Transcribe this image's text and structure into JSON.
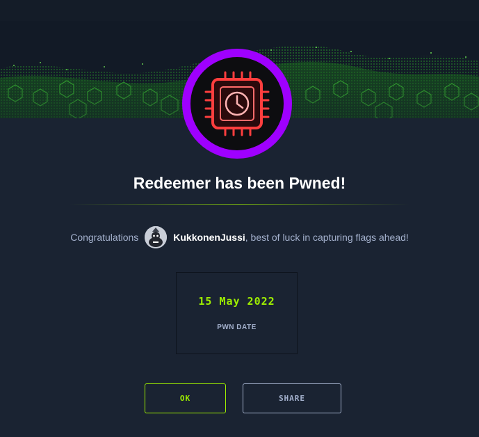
{
  "dialog": {
    "title": "Redeemer has been Pwned!",
    "congrats_prefix": "Congratulations",
    "username": "KukkonenJussi",
    "congrats_suffix": ", best of luck in capturing flags ahead!",
    "pwn_date": "15 May 2022",
    "pwn_date_label": "PWN DATE",
    "ok_label": "OK",
    "share_label": "SHARE"
  },
  "icons": {
    "badge": "cpu-chip-clock-icon",
    "avatar": "user-avatar"
  },
  "colors": {
    "background": "#1a2332",
    "accent_green": "#9fef00",
    "badge_ring": "#9f00ff",
    "chip_red": "#ff3e3e",
    "muted_text": "#a4b1cd"
  }
}
